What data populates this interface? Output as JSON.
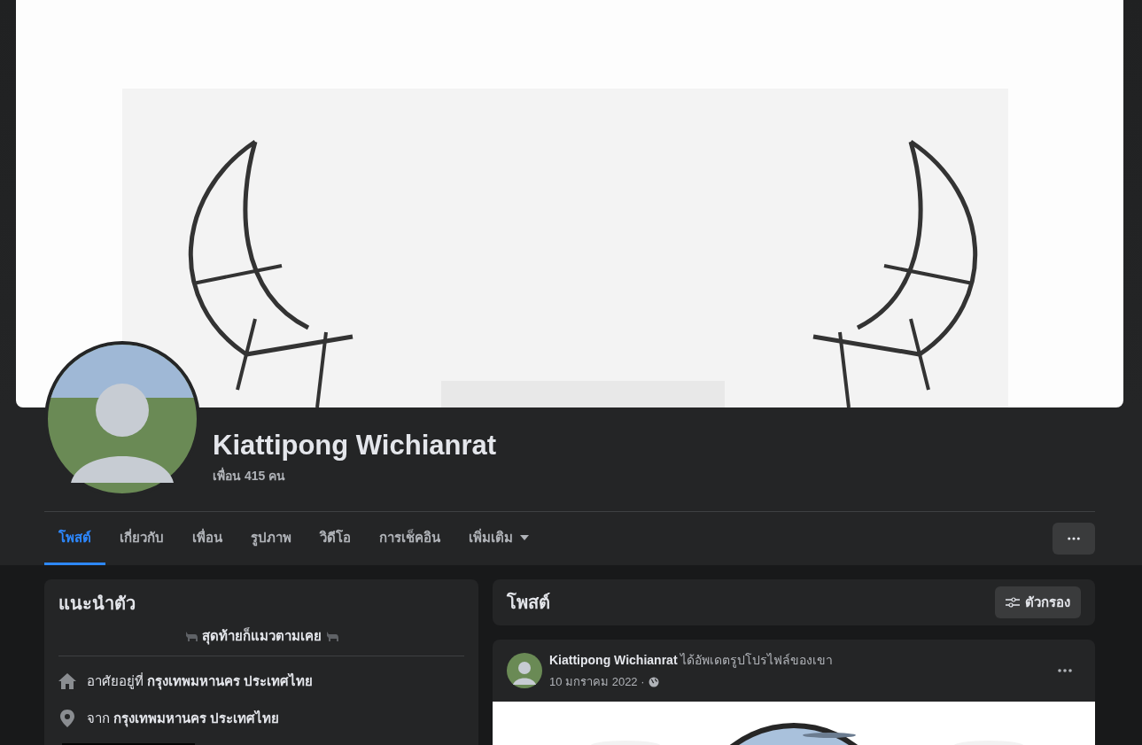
{
  "profile": {
    "name": "Kiattipong Wichianrat",
    "friends": "เพื่อน 415 คน"
  },
  "tabs": [
    {
      "label": "โพสต์",
      "selected": true,
      "kind": "tab"
    },
    {
      "label": "เกี่ยวกับ",
      "selected": false,
      "kind": "tab"
    },
    {
      "label": "เพื่อน",
      "selected": false,
      "kind": "tab"
    },
    {
      "label": "รูปภาพ",
      "selected": false,
      "kind": "tab"
    },
    {
      "label": "วิดีโอ",
      "selected": false,
      "kind": "tab"
    },
    {
      "label": "การเช็คอิน",
      "selected": false,
      "kind": "tab"
    },
    {
      "label": "เพิ่มเติม",
      "selected": false,
      "kind": "dropdown"
    }
  ],
  "intro": {
    "title": "แนะนำตัว",
    "bio": "สุดท้ายก็แมวตามเคย",
    "details": [
      {
        "kind": "home",
        "text": "อาศัยอยู่ที่ **กรุงเทพมหานคร ประเทศไทย**"
      },
      {
        "kind": "pin",
        "text": "จาก **กรุงเทพมหานคร ประเทศไทย**"
      }
    ]
  },
  "posts_header": {
    "title": "โพสต์",
    "filter": "ตัวกรอง"
  },
  "post": {
    "headline": "**Kiattipong Wichianrat** ได้อัพเดตรูปโปรไฟล์ของเขา",
    "date": "10 มกราคม 2022 ·"
  }
}
